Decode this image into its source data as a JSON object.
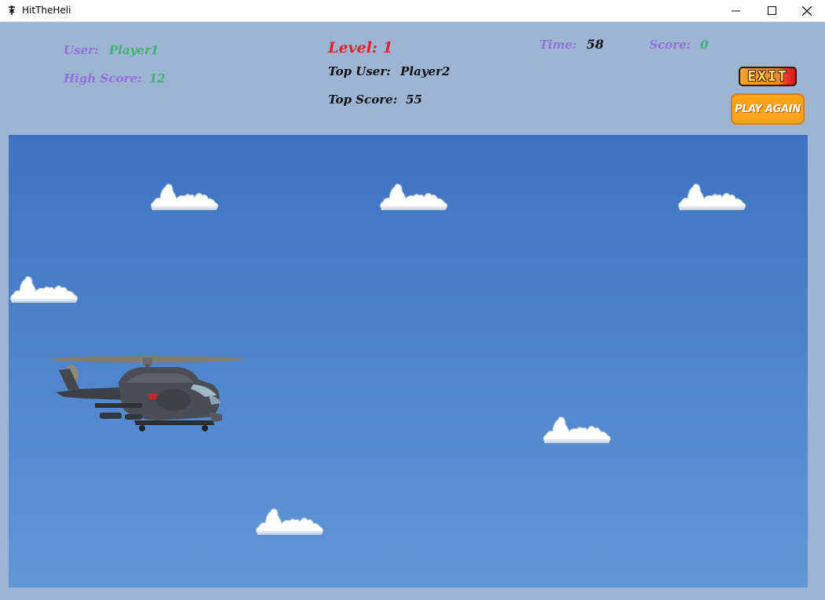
{
  "window": {
    "title": "HitTheHeli"
  },
  "hud": {
    "user_label": "User:",
    "user_value": "Player1",
    "high_score_label": "High Score:",
    "high_score_value": "12",
    "level_label": "Level: 1",
    "top_user_label": "Top User:",
    "top_user_value": "Player2",
    "top_score_label": "Top Score:",
    "top_score_value": "55",
    "time_label": "Time:",
    "time_value": "58",
    "score_label": "Score:",
    "score_value": "0"
  },
  "buttons": {
    "exit_label": "EXIT",
    "play_again_label": "PLAY AGAIN"
  },
  "colors": {
    "background": "#9db4d3",
    "sky": "#4c83cc",
    "label_purple": "#9370db",
    "value_green": "#3cb371",
    "level_red": "#e0202a",
    "button_orange": "#fca31c"
  },
  "icons": [
    "app-icon",
    "minimize-icon",
    "maximize-icon",
    "close-icon",
    "cloud",
    "helicopter"
  ]
}
